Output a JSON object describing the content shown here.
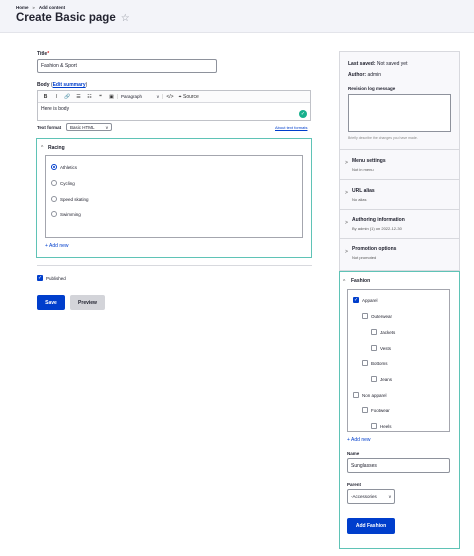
{
  "breadcrumb": {
    "home": "Home",
    "sep": ">",
    "current": "Add content"
  },
  "page": {
    "title": "Create Basic page",
    "star": "☆"
  },
  "title_field": {
    "label": "Title",
    "required": "*",
    "value": "Fashion & Sport"
  },
  "body_field": {
    "label": "Body",
    "edit_summary": "Edit summary",
    "content": "Here is body"
  },
  "toolbar": {
    "bold": "B",
    "italic": "I",
    "link": "🔗",
    "bullets": "☰",
    "numbers": "☷",
    "quote": "❝",
    "image": "▣",
    "paragraph": "Paragraph",
    "code": "</>",
    "source_icon": "⌖",
    "source": "Source"
  },
  "text_format": {
    "label": "Text format",
    "value": "Basic HTML",
    "about": "About text formats"
  },
  "racing": {
    "title": "Racing",
    "options": [
      "Athletics",
      "Cycling",
      "Speed skating",
      "Swimming"
    ],
    "selected": "Athletics",
    "add_new": "+ Add new"
  },
  "published": {
    "label": "Published",
    "checked": true
  },
  "actions": {
    "save": "Save",
    "preview": "Preview"
  },
  "sidebar": {
    "last_saved_label": "Last saved:",
    "last_saved_value": "Not saved yet",
    "author_label": "Author:",
    "author_value": "admin",
    "revision_label": "Revision log message",
    "revision_hint": "Briefly describe the changes you have made.",
    "sections": [
      {
        "title": "Menu settings",
        "sub": "Not in menu"
      },
      {
        "title": "URL alias",
        "sub": "No alias"
      },
      {
        "title": "Authoring information",
        "sub": "By admin (1) on 2022-12-30"
      },
      {
        "title": "Promotion options",
        "sub": "Not promoted"
      }
    ]
  },
  "fashion": {
    "title": "Fashion",
    "items": [
      {
        "label": "Apparel",
        "checked": true
      },
      {
        "label": "Outerwear",
        "checked": false
      },
      {
        "label": "Jackets",
        "checked": false
      },
      {
        "label": "Vests",
        "checked": false
      },
      {
        "label": "Bottoms",
        "checked": false
      },
      {
        "label": "Jeans",
        "checked": false
      },
      {
        "label": "Non apparel",
        "checked": false
      },
      {
        "label": "Footwear",
        "checked": false
      },
      {
        "label": "Heels",
        "checked": false
      }
    ],
    "add_new": "+ Add new",
    "name_label": "Name",
    "name_value": "Sunglasses",
    "parent_label": "Parent",
    "parent_value": "-Accessories",
    "add_button": "Add Fashion"
  },
  "icons": {
    "chevron_up": "^",
    "chevron_down": "v",
    "chevron_right": ">",
    "check": "✓"
  },
  "colors": {
    "primary": "#003ecc",
    "teal": "#5fc3b6",
    "header_bg": "#f3f4f9"
  }
}
